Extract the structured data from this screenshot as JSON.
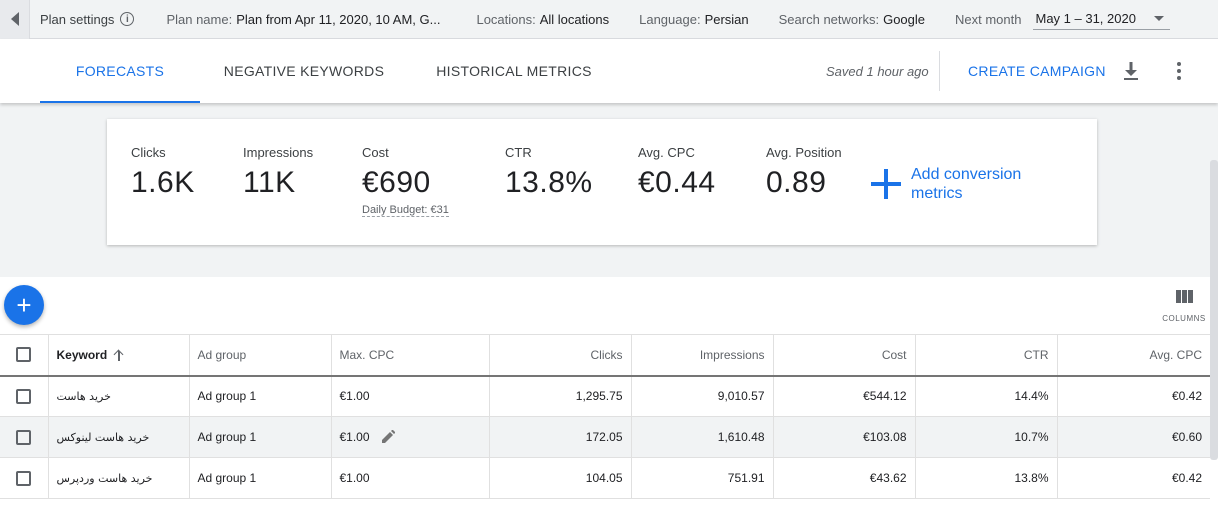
{
  "topbar": {
    "plan_settings": "Plan settings",
    "plan_name_label": "Plan name:",
    "plan_name_value": "Plan from Apr 11, 2020, 10 AM, G...",
    "locations_label": "Locations:",
    "locations_value": "All locations",
    "language_label": "Language:",
    "language_value": "Persian",
    "networks_label": "Search networks:",
    "networks_value": "Google",
    "period_label": "Next month",
    "period_value": "May 1 – 31, 2020"
  },
  "tabs": [
    {
      "label": "FORECASTS",
      "active": true
    },
    {
      "label": "NEGATIVE KEYWORDS",
      "active": false
    },
    {
      "label": "HISTORICAL METRICS",
      "active": false
    }
  ],
  "header": {
    "saved_status": "Saved 1 hour ago",
    "create_campaign": "CREATE CAMPAIGN"
  },
  "metrics": [
    {
      "label": "Clicks",
      "value": "1.6K"
    },
    {
      "label": "Impressions",
      "value": "11K"
    },
    {
      "label": "Cost",
      "value": "€690",
      "sub": "Daily Budget: €31"
    },
    {
      "label": "CTR",
      "value": "13.8%"
    },
    {
      "label": "Avg. CPC",
      "value": "€0.44"
    },
    {
      "label": "Avg. Position",
      "value": "0.89"
    }
  ],
  "add_conversion": {
    "line1": "Add conversion",
    "line2": "metrics"
  },
  "columns_label": "COLUMNS",
  "table": {
    "headers": [
      "Keyword",
      "Ad group",
      "Max. CPC",
      "Clicks",
      "Impressions",
      "Cost",
      "CTR",
      "Avg. CPC"
    ],
    "rows": [
      {
        "keyword": "خرید هاست",
        "ad_group": "Ad group 1",
        "max_cpc": "€1.00",
        "clicks": "1,295.75",
        "impressions": "9,010.57",
        "cost": "€544.12",
        "ctr": "14.4%",
        "avg_cpc": "€0.42"
      },
      {
        "keyword": "خرید هاست لینوکس",
        "ad_group": "Ad group 1",
        "max_cpc": "€1.00",
        "clicks": "172.05",
        "impressions": "1,610.48",
        "cost": "€103.08",
        "ctr": "10.7%",
        "avg_cpc": "€0.60"
      },
      {
        "keyword": "خرید هاست وردپرس",
        "ad_group": "Ad group 1",
        "max_cpc": "€1.00",
        "clicks": "104.05",
        "impressions": "751.91",
        "cost": "€43.62",
        "ctr": "13.8%",
        "avg_cpc": "€0.42"
      }
    ]
  },
  "colors": {
    "accent": "#1a73e8",
    "toolbar_bg": "#f1f3f4"
  },
  "icons": [
    "back-arrow-icon",
    "info-icon",
    "dropdown-caret-icon",
    "download-icon",
    "more-vert-icon",
    "plus-icon",
    "add-fab-icon",
    "columns-icon",
    "sort-ascending-icon",
    "pencil-icon"
  ]
}
